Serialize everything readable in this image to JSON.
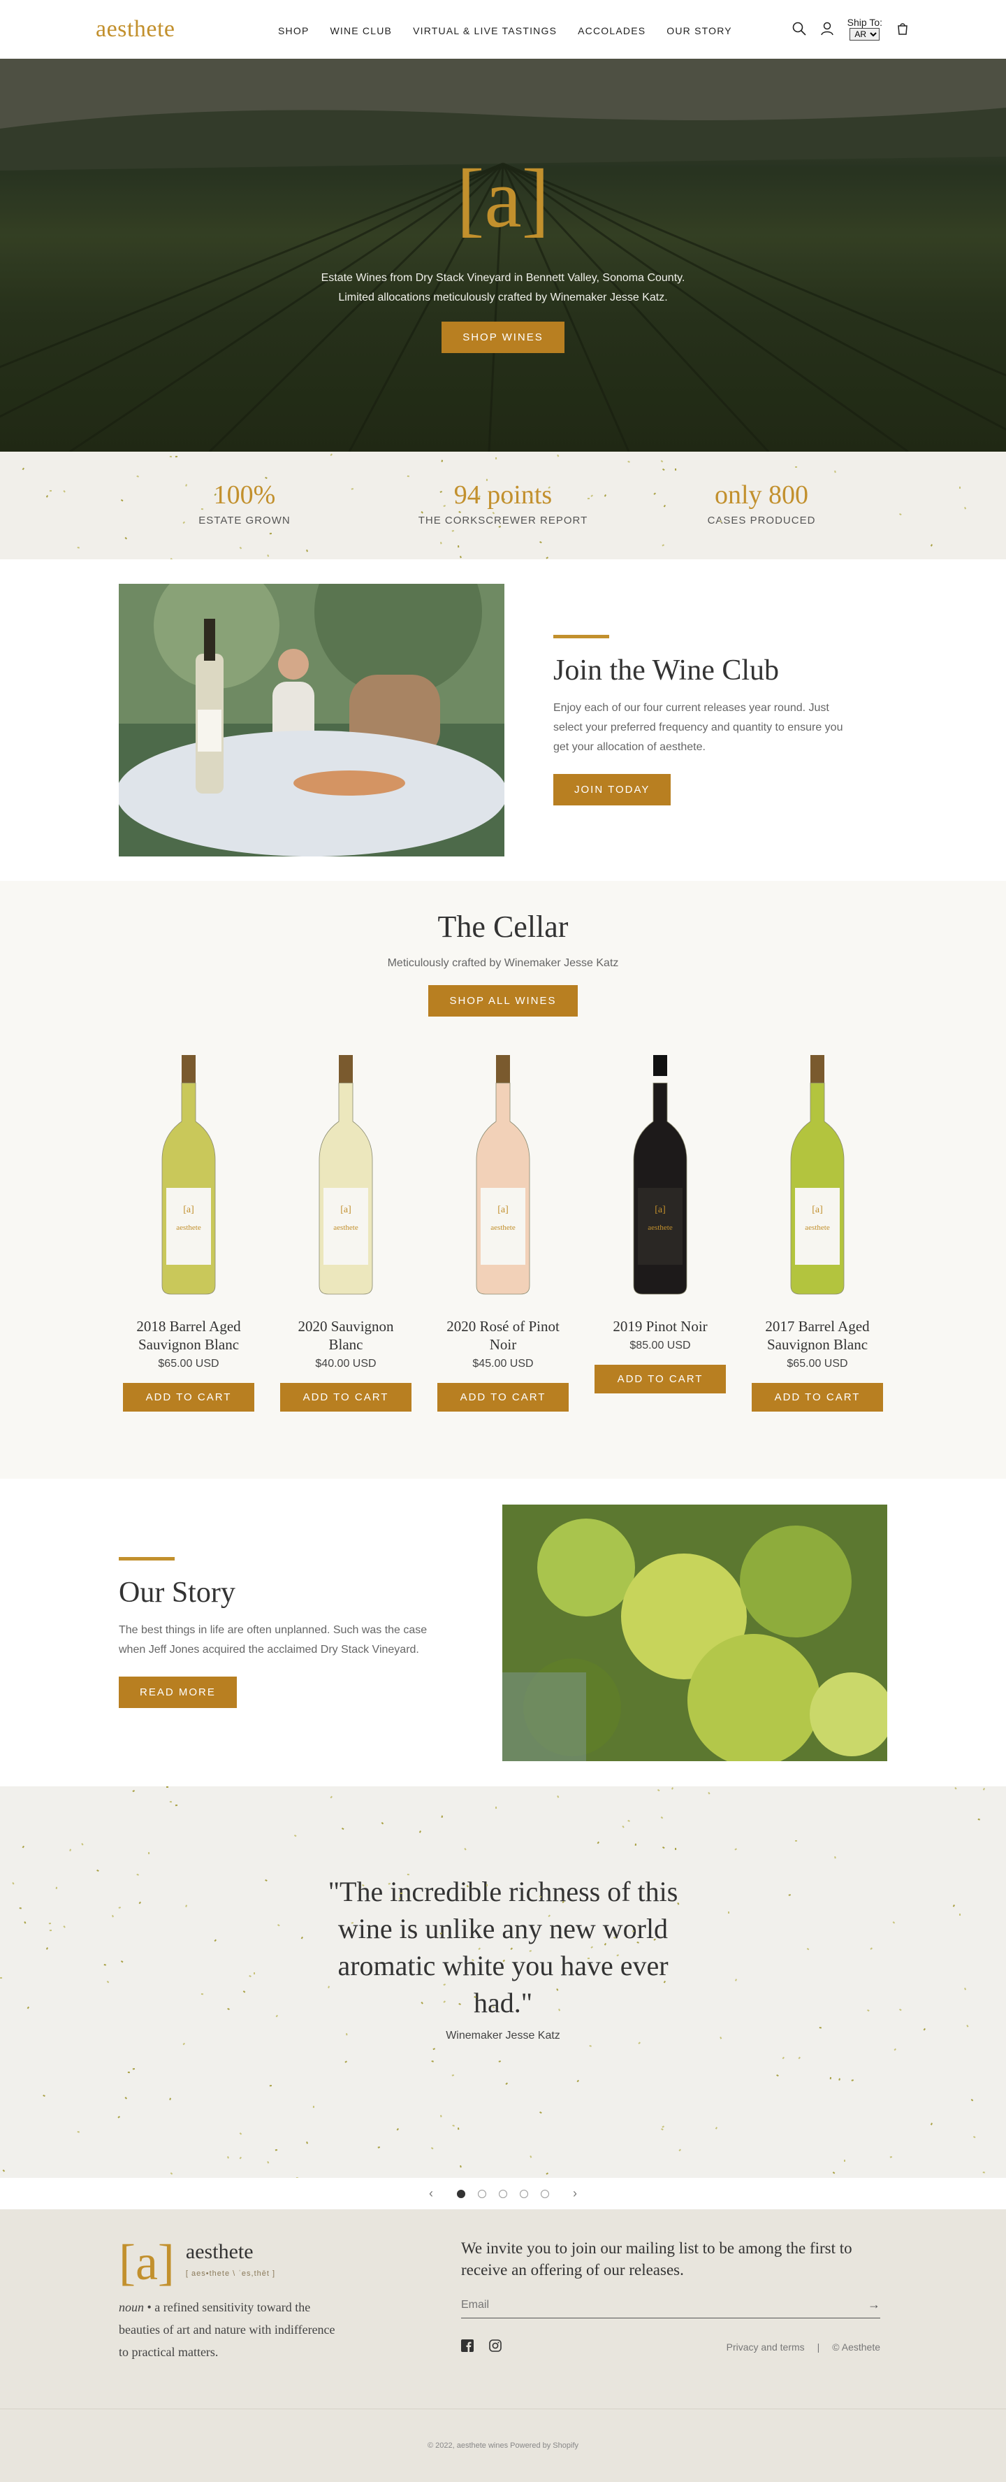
{
  "header": {
    "logo": "aesthete",
    "nav": [
      "SHOP",
      "WINE CLUB",
      "VIRTUAL & LIVE TASTINGS",
      "ACCOLADES",
      "OUR STORY"
    ],
    "ship_label": "Ship To:",
    "ship_value": "AR"
  },
  "hero": {
    "mark": "[a]",
    "line1": "Estate Wines from Dry Stack Vineyard in Bennett Valley, Sonoma County.",
    "line2": "Limited allocations meticulously crafted by Winemaker Jesse Katz.",
    "button": "SHOP WINES"
  },
  "stats": [
    {
      "value": "100%",
      "label": "ESTATE GROWN"
    },
    {
      "value": "94 points",
      "label": "THE CORKSCREWER REPORT"
    },
    {
      "value": "only 800",
      "label": "CASES PRODUCED"
    }
  ],
  "club": {
    "title": "Join the Wine Club",
    "body": "Enjoy each of our four current releases year round. Just select your preferred frequency and quantity to ensure you get your allocation of aesthete.",
    "button": "JOIN TODAY"
  },
  "cellar": {
    "title": "The Cellar",
    "subtitle": "Meticulously crafted by Winemaker Jesse Katz",
    "button": "SHOP ALL WINES",
    "add_label": "ADD TO CART",
    "products": [
      {
        "name": "2018 Barrel Aged Sauvignon Blanc",
        "price": "$65.00 USD",
        "glass": "#c9c85a"
      },
      {
        "name": "2020 Sauvignon Blanc",
        "price": "$40.00 USD",
        "glass": "#ece7bd"
      },
      {
        "name": "2020 Rosé of Pinot Noir",
        "price": "$45.00 USD",
        "glass": "#f2d1b8"
      },
      {
        "name": "2019 Pinot Noir",
        "price": "$85.00 USD",
        "glass": "#1d1a1a"
      },
      {
        "name": "2017 Barrel Aged Sauvignon Blanc",
        "price": "$65.00 USD",
        "glass": "#b3c43e"
      }
    ]
  },
  "story": {
    "title": "Our Story",
    "body": "The best things in life are often unplanned. Such was the case when Jeff Jones acquired the acclaimed Dry Stack Vineyard.",
    "button": "READ MORE"
  },
  "quote": {
    "text": "\"The incredible richness of this wine is unlike any new world aromatic white you have ever had.\"",
    "author": "Winemaker Jesse Katz"
  },
  "footer": {
    "mark": "[a]",
    "word": "aesthete",
    "pron": "[ aes•thete \\ ˈes,thēt ]",
    "def_prefix": "noun",
    "definition": " • a refined sensitivity toward the beauties of art and nature with indifference to practical matters.",
    "invite": "We invite you to join our mailing list to be among the first to receive an offering of our releases.",
    "email_placeholder": "Email",
    "privacy": "Privacy and terms",
    "separator": "|",
    "copyright_short": "© Aesthete",
    "copyright": "© 2022, aesthete wines Powered by Shopify"
  },
  "colors": {
    "gold": "#c2902d",
    "button": "#b87f21"
  }
}
